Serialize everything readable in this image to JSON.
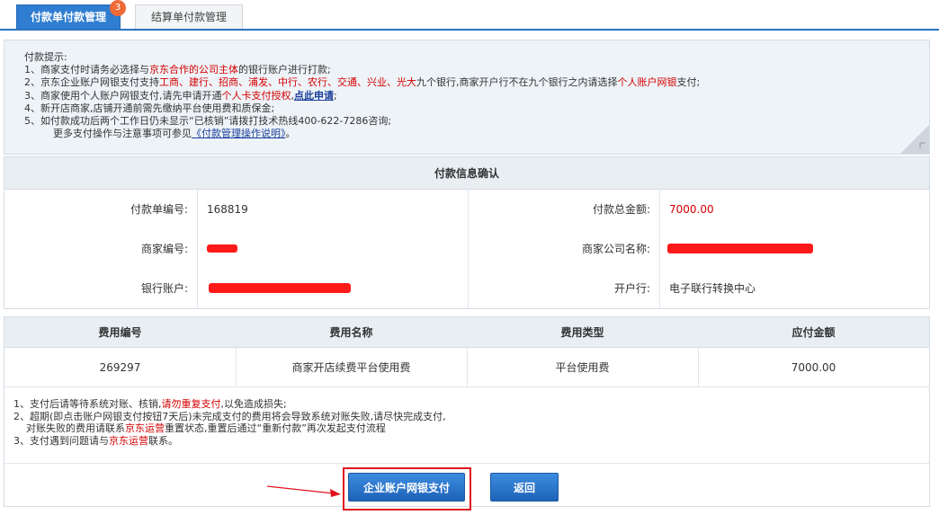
{
  "tabs": [
    {
      "label": "付款单付款管理",
      "badge": "3"
    },
    {
      "label": "结算单付款管理"
    }
  ],
  "tips": {
    "title": "付款提示:",
    "l1_a": "1、商家支付时请务必选择与",
    "l1_red": "京东合作的公司主体",
    "l1_b": "的银行账户进行打款;",
    "l2_a": "2、京东企业账户网银支付支持",
    "l2_red": "工商、建行、招商、浦发、中行、农行、交通、兴业、光大",
    "l2_b": "九个银行,商家开户行不在九个银行之内请选择",
    "l2_red2": "个人账户网银",
    "l2_c": "支付;",
    "l3_a": "3、商家使用个人账户网银支付,请先申请开通",
    "l3_red": "个人卡支付授权",
    "l3_b": ",",
    "l3_link": "点此申请",
    "l3_c": ";",
    "l4": "4、新开店商家,店铺开通前需先缴纳平台使用费和质保金;",
    "l5": "5、如付款成功后两个工作日仍未显示“已核销”请拨打技术热线400-622-7286咨询;",
    "l6_a": "更多支付操作与注意事项可参见",
    "l6_link": "《付款管理操作说明》",
    "l6_b": "。"
  },
  "info": {
    "title": "付款信息确认",
    "order_no_label": "付款单编号:",
    "order_no": "168819",
    "total_label": "付款总金额:",
    "total": "7000.00",
    "merchant_no_label": "商家编号:",
    "company_label": "商家公司名称:",
    "account_label": "银行账户:",
    "bank_label": "开户行:",
    "bank": "电子联行转换中心"
  },
  "fees": {
    "headers": [
      "费用编号",
      "费用名称",
      "费用类型",
      "应付金额"
    ],
    "rows": [
      [
        "269297",
        "商家开店续费平台使用费",
        "平台使用费",
        "7000.00"
      ]
    ]
  },
  "notes": {
    "n1_a": "1、支付后请等待系统对账、核销,",
    "n1_red": "请勿重复支付",
    "n1_b": ",以免造成损失;",
    "n2": "2、超期(即点击账户网银支付按钮7天后)未完成支付的费用将会导致系统对账失败,请尽快完成支付,",
    "n2b_a": "对账失败的费用请联系",
    "n2b_red": "京东运营",
    "n2b_b": "重置状态,重置后通过“重新付款”再次发起支付流程",
    "n3_a": "3、支付遇到问题请与",
    "n3_red": "京东运营",
    "n3_b": "联系。"
  },
  "buttons": {
    "pay": "企业账户网银支付",
    "back": "返回"
  }
}
